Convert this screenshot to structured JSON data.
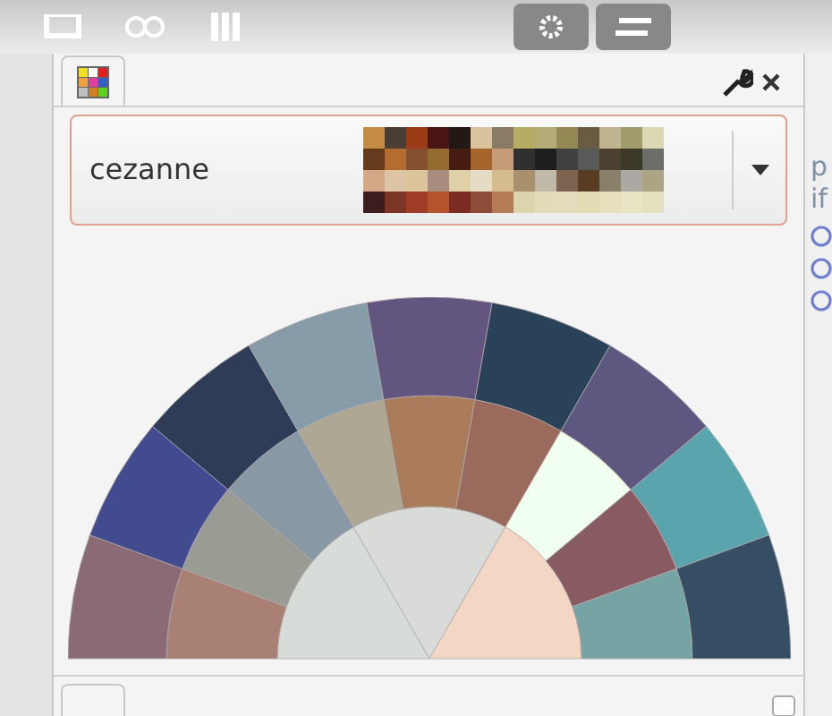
{
  "palette_selector": {
    "name": "cezanne",
    "swatches": [
      {
        "color": "#c48c44"
      },
      {
        "color": "#4a3e34"
      },
      {
        "color": "#9a3c16"
      },
      {
        "color": "#4a1414"
      },
      {
        "color": "#241814"
      },
      {
        "color": "#d8c49c"
      },
      {
        "color": "#8a7c64"
      },
      {
        "color": "#b8ac64"
      },
      {
        "color": "#b4ac78"
      },
      {
        "color": "#948854"
      },
      {
        "color": "#6a5c44"
      },
      {
        "color": "#c0b490"
      },
      {
        "color": "#a09c6c"
      },
      {
        "color": "#dcd8b4"
      },
      {
        "color": "#643c1c"
      },
      {
        "color": "#b46c30"
      },
      {
        "color": "#845030"
      },
      {
        "color": "#946c30"
      },
      {
        "color": "#441c10"
      },
      {
        "color": "#a4642c"
      },
      {
        "color": "#c49c78"
      },
      {
        "color": "#303030"
      },
      {
        "color": "#1e1e1e"
      },
      {
        "color": "#404040"
      },
      {
        "color": "#585a58"
      },
      {
        "color": "#4c4030"
      },
      {
        "color": "#3c3828"
      },
      {
        "color": "#6c6c68"
      },
      {
        "color": "#d4a884"
      },
      {
        "color": "#dcc4a4"
      },
      {
        "color": "#dcc49c"
      },
      {
        "color": "#a88c80"
      },
      {
        "color": "#e0d0a8"
      },
      {
        "color": "#e4dcc4"
      },
      {
        "color": "#d4bc8c"
      },
      {
        "color": "#a8906c"
      },
      {
        "color": "#c0b8a8"
      },
      {
        "color": "#7c6450"
      },
      {
        "color": "#583c24"
      },
      {
        "color": "#888068"
      },
      {
        "color": "#aca8a4"
      },
      {
        "color": "#aca484"
      },
      {
        "color": "#3c1c1c"
      },
      {
        "color": "#7c3424"
      },
      {
        "color": "#a03c28"
      },
      {
        "color": "#b4542c"
      },
      {
        "color": "#7c2c24"
      },
      {
        "color": "#8c4c38"
      },
      {
        "color": "#b47c54"
      },
      {
        "color": "#dcd4ac"
      },
      {
        "color": "#e4dcb8"
      },
      {
        "color": "#e4dcbc"
      },
      {
        "color": "#e4dcb4"
      },
      {
        "color": "#e8e0bc"
      },
      {
        "color": "#e8e4c4"
      },
      {
        "color": "#e4e0c0"
      }
    ]
  },
  "wheel": {
    "rings": [
      {
        "segments": [
          {
            "color": "#d8dcd8"
          },
          {
            "color": "#d8dbd8"
          },
          {
            "color": "#f3d6c4"
          }
        ]
      },
      {
        "segments": [
          {
            "color": "#a88074"
          },
          {
            "color": "#9a9c94"
          },
          {
            "color": "#8898a4"
          },
          {
            "color": "#aea794"
          },
          {
            "color": "#aa7c5c"
          },
          {
            "color": "#9a6a5c"
          },
          {
            "color": "#f0fff0"
          },
          {
            "color": "#885a62"
          },
          {
            "color": "#76a4a4"
          }
        ]
      },
      {
        "segments": [
          {
            "color": "#8a6a74"
          },
          {
            "color": "#434b90"
          },
          {
            "color": "#2e3c58"
          },
          {
            "color": "#869ca8"
          },
          {
            "color": "#625580"
          },
          {
            "color": "#2a4258"
          },
          {
            "color": "#5e5880"
          },
          {
            "color": "#5aa4ae"
          },
          {
            "color": "#364e64"
          }
        ]
      }
    ]
  },
  "side_panel": {
    "lines": [
      "p",
      "if"
    ]
  }
}
